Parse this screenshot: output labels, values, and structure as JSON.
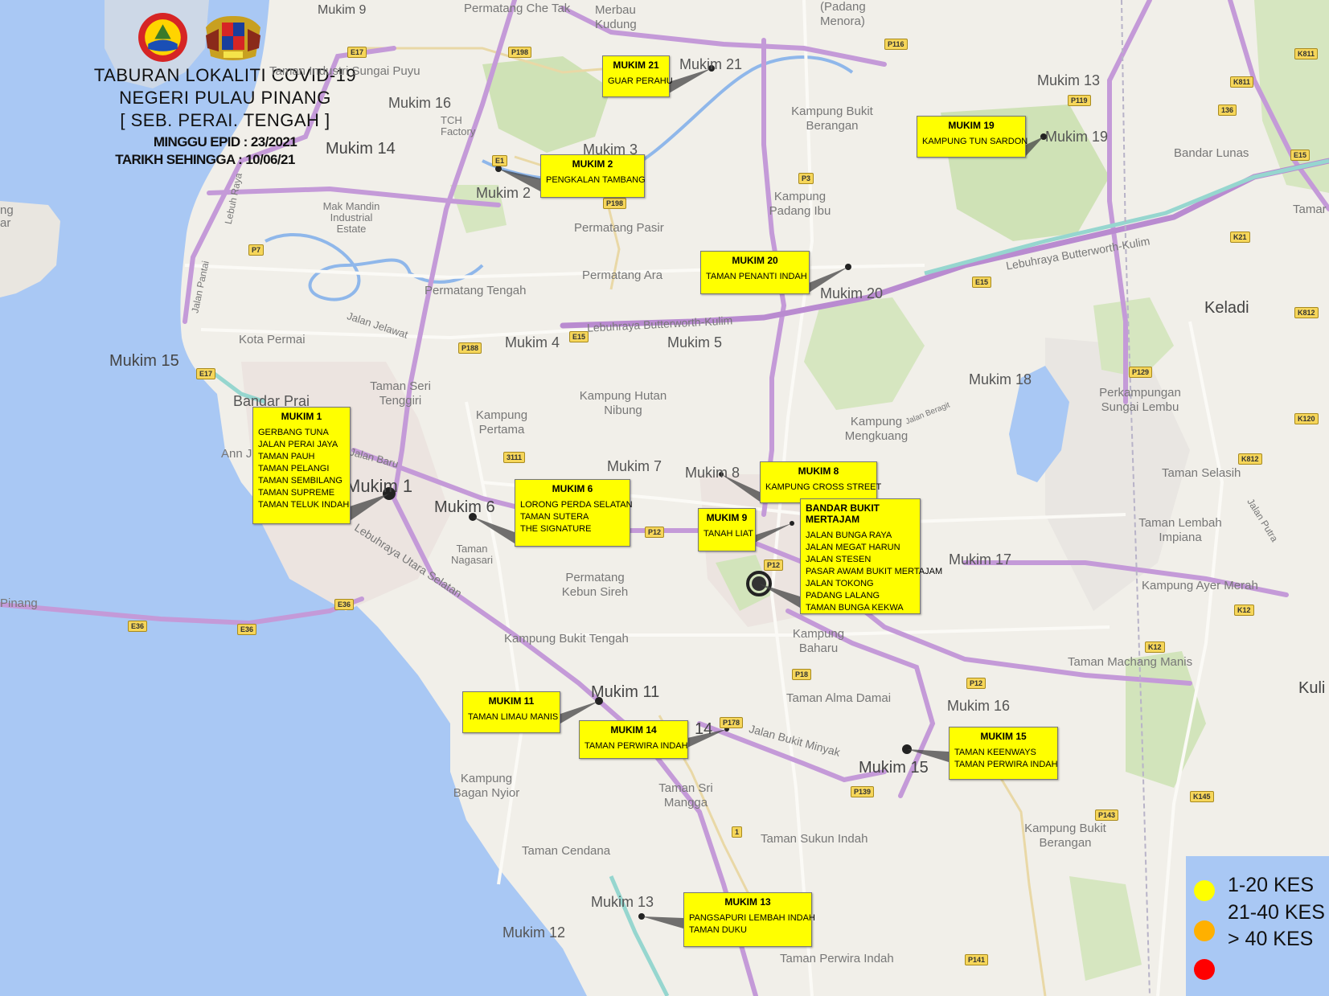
{
  "header": {
    "title_line1": "TABURAN LOKALITI COVID-19",
    "title_line2": "NEGERI PULAU PINANG",
    "title_line3": "[ SEB. PERAI. TENGAH ]",
    "epid_week": "MINGGU EPID : 23/2021",
    "as_of_date": "TARIKH SEHINGGA : 10/06/21"
  },
  "logos": [
    "district-seal-icon",
    "state-crest-icon"
  ],
  "legend": [
    {
      "label": "1-20 KES",
      "color": "#ffff00"
    },
    {
      "label": "21-40 KES",
      "color": "#ffb000"
    },
    {
      "label": "> 40 KES",
      "color": "#ff0000"
    }
  ],
  "callouts": [
    {
      "title": "MUKIM 21",
      "items": [
        "GUAR PERAHU"
      ]
    },
    {
      "title": "MUKIM 2",
      "items": [
        "PENGKALAN TAMBANG"
      ]
    },
    {
      "title": "MUKIM 19",
      "items": [
        "KAMPUNG TUN SARDON"
      ]
    },
    {
      "title": "MUKIM 20",
      "items": [
        "TAMAN PENANTI INDAH"
      ]
    },
    {
      "title": "MUKIM 1",
      "items": [
        "GERBANG TUNA",
        "JALAN PERAI JAYA",
        "TAMAN PAUH",
        "TAMAN PELANGI",
        "TAMAN SEMBILANG",
        "TAMAN SUPREME",
        "TAMAN TELUK INDAH"
      ]
    },
    {
      "title": "MUKIM 6",
      "items": [
        "LORONG PERDA SELATAN",
        "TAMAN SUTERA",
        "THE SIGNATURE"
      ]
    },
    {
      "title": "MUKIM 8",
      "items": [
        "KAMPUNG CROSS STREET"
      ]
    },
    {
      "title": "MUKIM 9",
      "items": [
        "TANAH LIAT"
      ]
    },
    {
      "title": "BANDAR BUKIT MERTAJAM",
      "items": [
        "JALAN BUNGA RAYA",
        "JALAN MEGAT HARUN",
        "JALAN STESEN",
        "PASAR AWAM BUKIT MERTAJAM",
        "JALAN TOKONG",
        "PADANG LALANG",
        "TAMAN BUNGA KEKWA"
      ]
    },
    {
      "title": "MUKIM 11",
      "items": [
        "TAMAN LIMAU MANIS"
      ]
    },
    {
      "title": "MUKIM 14",
      "items": [
        "TAMAN PERWIRA INDAH"
      ]
    },
    {
      "title": "MUKIM 15",
      "items": [
        "TAMAN KEENWAYS",
        "TAMAN PERWIRA INDAH"
      ]
    },
    {
      "title": "MUKIM 13",
      "items": [
        "PANGSAPURI LEMBAH INDAH",
        "TAMAN DUKU"
      ]
    }
  ],
  "places": [
    {
      "label": "Mukim 9"
    },
    {
      "label": "Permatang Che Tak"
    },
    {
      "label": "Merbau Kudung"
    },
    {
      "label": "(Padang Menora)"
    },
    {
      "label": "Mukim 21"
    },
    {
      "label": "Mukim 13"
    },
    {
      "label": "Taman Industri Sungai Puyu"
    },
    {
      "label": "Mukim 16"
    },
    {
      "label": "TCH Factory"
    },
    {
      "label": "Mukim 14"
    },
    {
      "label": "Mukim 3"
    },
    {
      "label": "Kampung Bukit Berangan"
    },
    {
      "label": "Mukim 19"
    },
    {
      "label": "Bandar Lunas"
    },
    {
      "label": "Mukim 2"
    },
    {
      "label": "Kampung Padang Ibu"
    },
    {
      "label": "Mak Mandin Industrial Estate"
    },
    {
      "label": "Permatang Pasir"
    },
    {
      "label": "Permatang Ara"
    },
    {
      "label": "Mukim 20"
    },
    {
      "label": "Permatang Tengah"
    },
    {
      "label": "Keladi"
    },
    {
      "label": "Kota Permai"
    },
    {
      "label": "Mukim 4"
    },
    {
      "label": "Mukim 5"
    },
    {
      "label": "Mukim 15"
    },
    {
      "label": "Mukim 18"
    },
    {
      "label": "Bandar Prai"
    },
    {
      "label": "Taman Seri Tenggiri"
    },
    {
      "label": "Kampung Hutan Nibung"
    },
    {
      "label": "Kampung Pertama"
    },
    {
      "label": "Perkampungan Sungai Lembu"
    },
    {
      "label": "Kampung Mengkuang"
    },
    {
      "label": "Mukim 7"
    },
    {
      "label": "Mukim 8"
    },
    {
      "label": "Taman Selasih"
    },
    {
      "label": "Mukim 1"
    },
    {
      "label": "Mukim 6"
    },
    {
      "label": "Taman Nagasari"
    },
    {
      "label": "Permatang Kebun Sireh"
    },
    {
      "label": "Mukim 17"
    },
    {
      "label": "Taman Lembah Impiana"
    },
    {
      "label": "Kampung Ayer Merah"
    },
    {
      "label": "Kampung Baharu"
    },
    {
      "label": "Kampung Bukit Tengah"
    },
    {
      "label": "Taman Machang Manis"
    },
    {
      "label": "Mukim 11"
    },
    {
      "label": "Taman Alma Damai"
    },
    {
      "label": "Mukim 16"
    },
    {
      "label": "14"
    },
    {
      "label": "Mukim 15"
    },
    {
      "label": "Kampung Bagan Nyior"
    },
    {
      "label": "Taman Sri Mangga"
    },
    {
      "label": "Taman Sukun Indah"
    },
    {
      "label": "Kampung Bukit Berangan"
    },
    {
      "label": "Taman Cendana"
    },
    {
      "label": "Mukim 13"
    },
    {
      "label": "Mukim 12"
    },
    {
      "label": "Taman Perwira Indah"
    },
    {
      "label": "Kuli"
    },
    {
      "label": "Tamar"
    },
    {
      "label": "Ann J"
    },
    {
      "label": "ng ar"
    },
    {
      "label": "Pinang"
    }
  ],
  "roads": [
    {
      "label": "Lebuhraya Butterworth-Kulim"
    },
    {
      "label": "Lebuhraya Butterworth-Kulim"
    },
    {
      "label": "Lebuhraya Utara Selatan"
    },
    {
      "label": "Jalan Pantai"
    },
    {
      "label": "Lebuh Raya"
    },
    {
      "label": "Jalan Jelawat"
    },
    {
      "label": "Jalan Baru"
    },
    {
      "label": "Jalan Bukit Minyak"
    },
    {
      "label": "Jalan Putra"
    },
    {
      "label": "Jalan Beragit"
    }
  ],
  "shields": [
    "E17",
    "P198",
    "E1",
    "P198",
    "P116",
    "P119",
    "136",
    "K811",
    "K811",
    "P3",
    "E15",
    "P7",
    "E15",
    "P188",
    "E17",
    "E15",
    "K21",
    "K812",
    "P129",
    "K120",
    "3111",
    "K812",
    "P12",
    "P12",
    "E36",
    "E36",
    "E36",
    "P18",
    "K12",
    "K12",
    "P12",
    "P178",
    "P139",
    "K145",
    "P143",
    "1",
    "P141"
  ]
}
